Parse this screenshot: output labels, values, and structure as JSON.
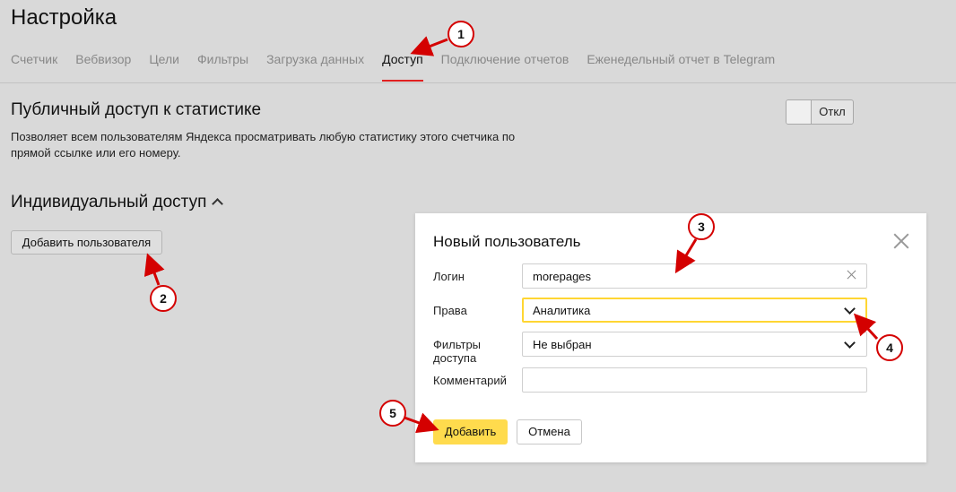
{
  "page": {
    "title": "Настройка"
  },
  "tabs": [
    {
      "label": "Счетчик",
      "active": false
    },
    {
      "label": "Вебвизор",
      "active": false
    },
    {
      "label": "Цели",
      "active": false
    },
    {
      "label": "Фильтры",
      "active": false
    },
    {
      "label": "Загрузка данных",
      "active": false
    },
    {
      "label": "Доступ",
      "active": true
    },
    {
      "label": "Подключение отчетов",
      "active": false
    },
    {
      "label": "Еженедельный отчет в Telegram",
      "active": false
    }
  ],
  "public_access": {
    "title": "Публичный доступ к статистике",
    "description": "Позволяет всем пользователям Яндекса просматривать любую статистику этого счетчика по прямой ссылке или его номеру.",
    "toggle_label": "Откл"
  },
  "individual_access": {
    "title": "Индивидуальный доступ",
    "add_user_label": "Добавить пользователя"
  },
  "dialog": {
    "title": "Новый пользователь",
    "login": {
      "label": "Логин",
      "value": "morepages"
    },
    "rights": {
      "label": "Права",
      "value": "Аналитика"
    },
    "filters": {
      "label": "Фильтры доступа",
      "value": "Не выбран"
    },
    "comment": {
      "label": "Комментарий",
      "value": ""
    },
    "submit_label": "Добавить",
    "cancel_label": "Отмена"
  },
  "annotations": [
    "1",
    "2",
    "3",
    "4",
    "5"
  ],
  "colors": {
    "background": "#d9d9d9",
    "active_tab_underline": "#e02020",
    "primary_button": "#ffdb4d",
    "focus_border": "#ffd633",
    "annotation": "#d40000"
  }
}
